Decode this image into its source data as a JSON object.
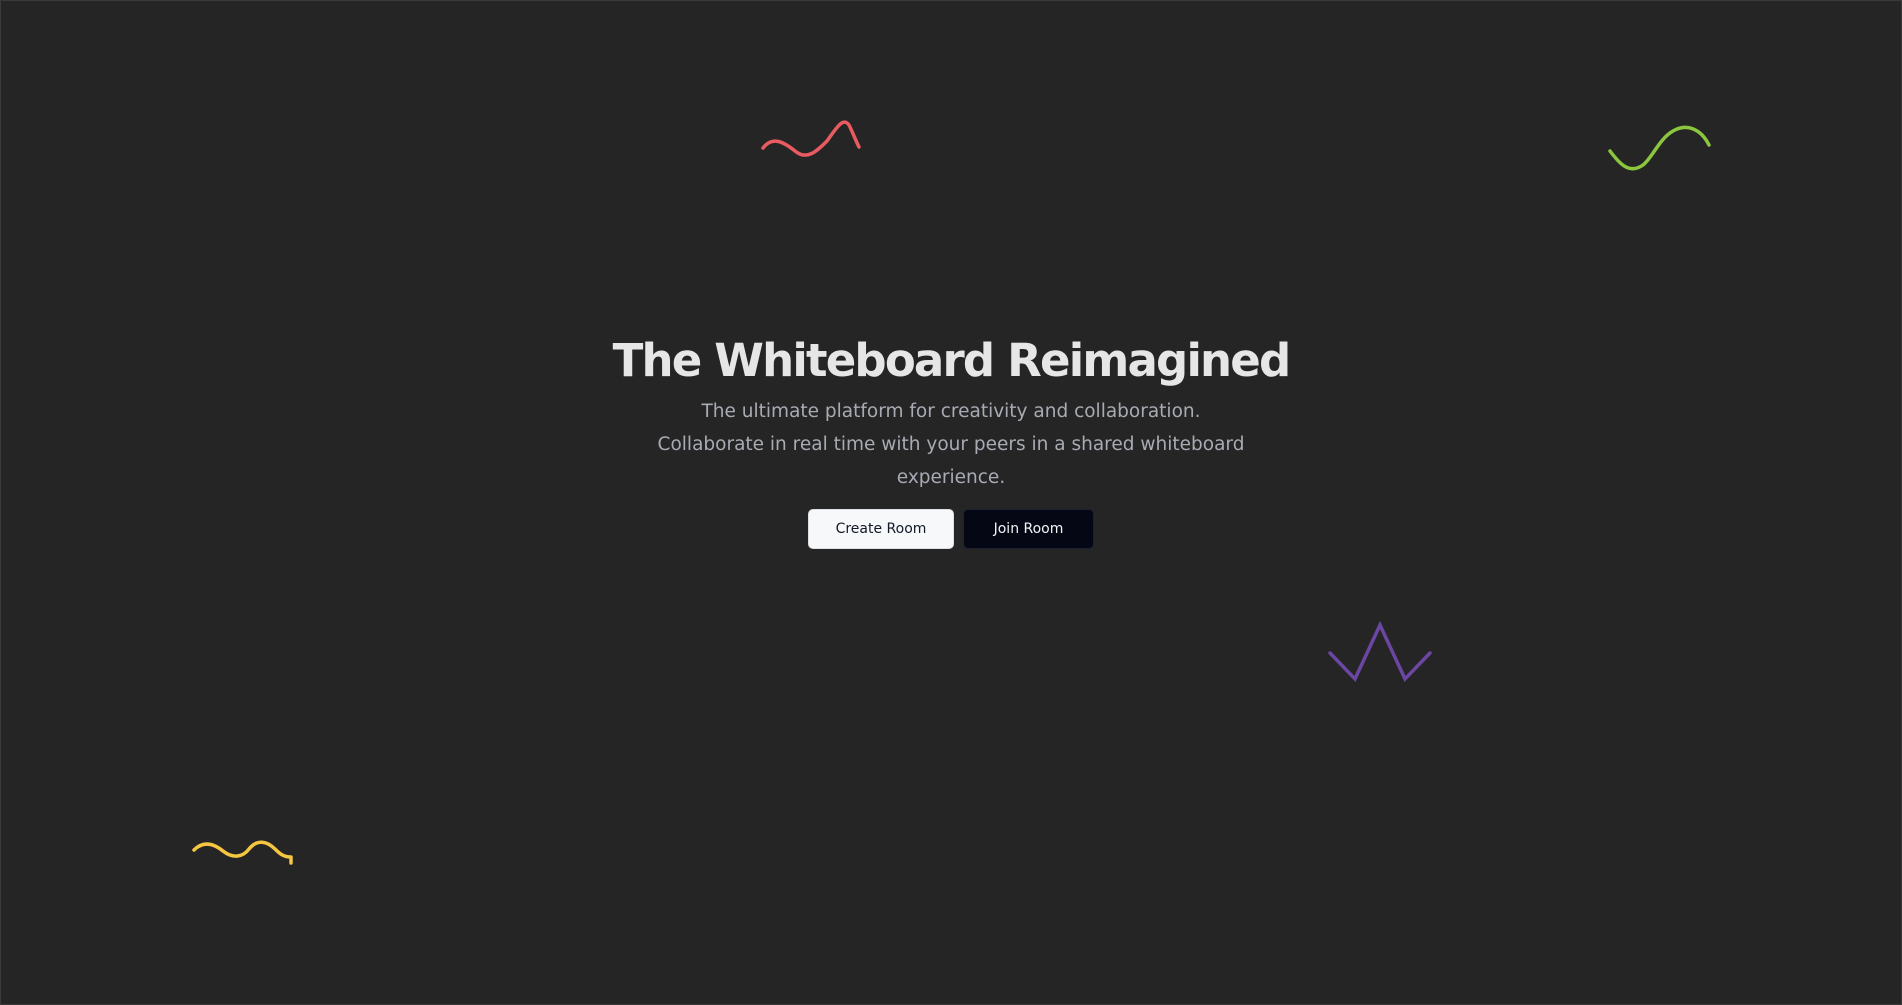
{
  "hero": {
    "title": "The Whiteboard Reimagined",
    "subtitle": "The ultimate platform for creativity and collaboration. Collaborate in real time with your peers in a shared whiteboard experience."
  },
  "actions": {
    "create_label": "Create Room",
    "join_label": "Join Room"
  },
  "decorations": {
    "squiggle_colors": [
      "#e85b60",
      "#8cc63e",
      "#f5c641",
      "#6b46a3"
    ]
  },
  "theme": {
    "background": "#252525",
    "title_color": "#e6e6e6",
    "subtitle_color": "#a8abb3",
    "create_bg": "#f7f8fa",
    "join_bg": "#050814"
  }
}
